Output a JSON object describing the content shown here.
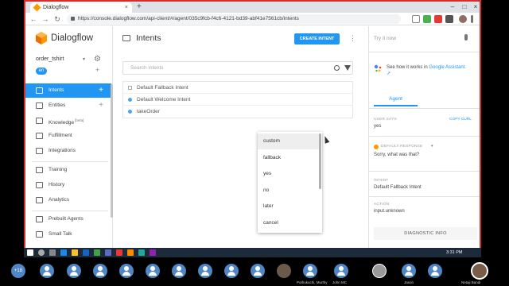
{
  "browser": {
    "tab_title": "Dialogflow",
    "tab_close": "×",
    "new_tab": "+",
    "url": "https://console.dialogflow.com/api-client/#/agent/035c9fcb-f4c6-4121-bd39-abf41e7561cb/intents",
    "window_controls": [
      "–",
      "□",
      "×"
    ]
  },
  "nav_buttons": [
    "←",
    "→",
    "↻"
  ],
  "sidebar": {
    "brand": "Dialogflow",
    "agent_name": "order_tshirt",
    "agent_caret": "▾",
    "language": "en",
    "items": [
      {
        "label": "Intents",
        "active": true,
        "plus": "+"
      },
      {
        "label": "Entities",
        "plus": "+"
      },
      {
        "label": "Knowledge",
        "badge": "[beta]"
      },
      {
        "label": "Fulfillment"
      },
      {
        "label": "Integrations"
      },
      {
        "label": "Training"
      },
      {
        "label": "History"
      },
      {
        "label": "Analytics"
      },
      {
        "label": "Prebuilt Agents"
      },
      {
        "label": "Small Talk"
      }
    ]
  },
  "main": {
    "title": "Intents",
    "create_button": "CREATE INTENT",
    "kebab": "⋮",
    "search_placeholder": "Search intents",
    "intents": [
      {
        "label": "Default Fallback Intent",
        "marker": "square"
      },
      {
        "label": "Default Welcome Intent",
        "marker": "dot"
      },
      {
        "label": "takeOrder",
        "marker": "dot"
      }
    ],
    "dropdown": [
      "custom",
      "fallback",
      "yes",
      "no",
      "later",
      "cancel"
    ]
  },
  "right_panel": {
    "try_placeholder": "Try it now",
    "ga_text": "See how it works in ",
    "ga_link": "Google Assistant.",
    "ga_link_icon": "↗",
    "agent_tab": "Agent",
    "user_says_label": "USER SAYS",
    "copy_curl": "COPY CURL",
    "user_says_value": "yes",
    "default_response_label": "DEFAULT RESPONSE",
    "default_response_caret": "▾",
    "default_response_value": "Sorry, what was that?",
    "intent_label": "INTENT",
    "intent_value": "Default Fallback Intent",
    "action_label": "ACTION",
    "action_value": "input.unknown",
    "diagnostic_button": "DIAGNOSTIC INFO"
  },
  "taskbar": {
    "time": "3:31 PM"
  },
  "meeting": {
    "more_count": "+18",
    "participants": [
      "Pothukuchi, Murthy",
      "John MC",
      "Jason",
      "Netaji Bandi"
    ]
  },
  "colors": {
    "accent": "#2196f3",
    "brand_orange": "#ff9800"
  }
}
